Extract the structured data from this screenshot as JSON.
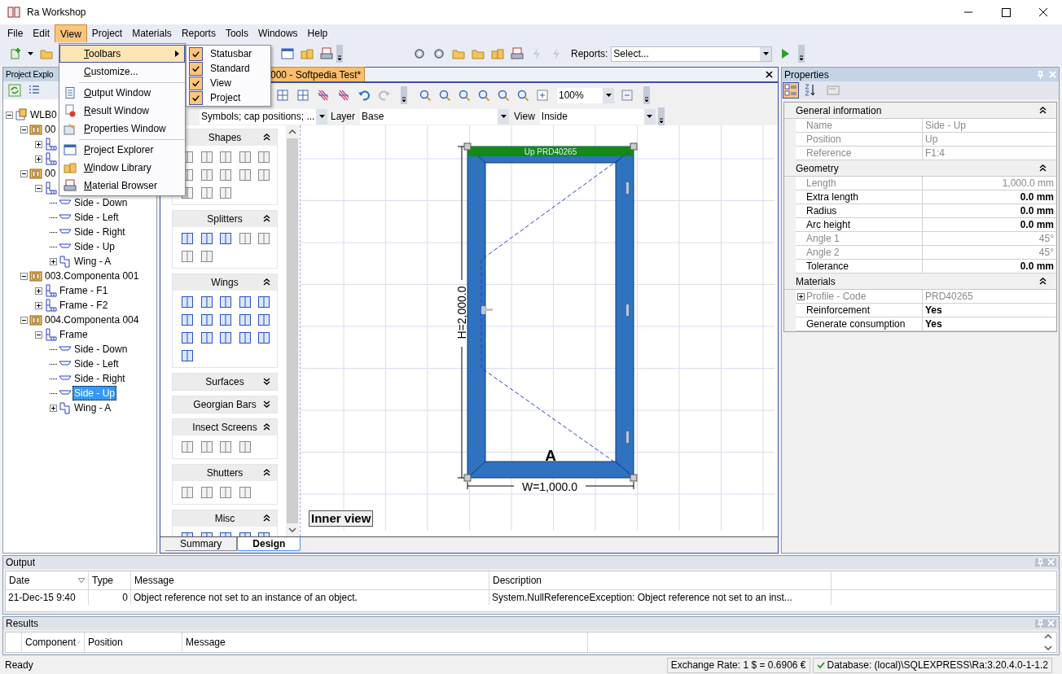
{
  "window": {
    "title": "Ra Workshop"
  },
  "menu": [
    {
      "label": "File",
      "selected": false
    },
    {
      "label": "Edit",
      "selected": false
    },
    {
      "label": "View",
      "selected": true
    },
    {
      "label": "Project",
      "selected": false
    },
    {
      "label": "Materials",
      "selected": false
    },
    {
      "label": "Reports",
      "selected": false
    },
    {
      "label": "Tools",
      "selected": false
    },
    {
      "label": "Windows",
      "selected": false
    },
    {
      "label": "Help",
      "selected": false
    }
  ],
  "view_menu": {
    "groups": [
      [
        {
          "label": "Toolbars",
          "kind": "submenu",
          "selected": true
        },
        {
          "label": "Customize...",
          "kind": "item",
          "selected": false
        }
      ],
      [
        {
          "label": "Output Window",
          "kind": "item",
          "selected": false
        },
        {
          "label": "Result Window",
          "kind": "item",
          "selected": false
        },
        {
          "label": "Properties Window",
          "kind": "item",
          "selected": false
        }
      ],
      [
        {
          "label": "Project Explorer",
          "kind": "item",
          "selected": false
        },
        {
          "label": "Window Library",
          "kind": "item",
          "selected": false
        },
        {
          "label": "Material Browser",
          "kind": "item",
          "selected": false
        }
      ]
    ]
  },
  "toolbars_submenu": [
    {
      "label": "Statusbar",
      "checked": true
    },
    {
      "label": "Standard",
      "checked": true
    },
    {
      "label": "View",
      "checked": true
    },
    {
      "label": "Project",
      "checked": true
    }
  ],
  "toolbar": {
    "reports_label": "Reports:",
    "reports_select": "Select..."
  },
  "project_explorer": {
    "title": "Project Explo",
    "tree": [
      {
        "label": "WLB0",
        "kind": "project",
        "expanded": true,
        "selected": false,
        "children": [
          {
            "label": "00",
            "kind": "component",
            "expanded": true,
            "selected": false,
            "children": [
              {
                "kind": "frame",
                "expanded": false,
                "selected": false
              },
              {
                "kind": "frame",
                "expanded": false,
                "selected": false
              }
            ]
          },
          {
            "label": "00",
            "kind": "component",
            "expanded": true,
            "selected": false,
            "children": [
              {
                "kind": "frame",
                "expanded": true,
                "selected": false,
                "children": [
                  {
                    "label": "Side - Down",
                    "kind": "side",
                    "selected": false
                  },
                  {
                    "label": "Side - Left",
                    "kind": "side",
                    "selected": false
                  },
                  {
                    "label": "Side - Right",
                    "kind": "side",
                    "selected": false
                  },
                  {
                    "label": "Side - Up",
                    "kind": "side",
                    "selected": false
                  },
                  {
                    "label": "Wing - A",
                    "kind": "wing",
                    "expanded": false,
                    "selected": false
                  }
                ]
              }
            ]
          },
          {
            "label": "003.Componenta 001",
            "kind": "component",
            "expanded": true,
            "selected": false,
            "children": [
              {
                "label": "Frame - F1",
                "kind": "frame",
                "expanded": false,
                "selected": false
              },
              {
                "label": "Frame - F2",
                "kind": "frame",
                "expanded": false,
                "selected": false
              }
            ]
          },
          {
            "label": "004.Componenta 004",
            "kind": "component",
            "expanded": true,
            "selected": false,
            "children": [
              {
                "label": "Frame",
                "kind": "frame",
                "expanded": true,
                "selected": false,
                "children": [
                  {
                    "label": "Side - Down",
                    "kind": "side",
                    "selected": false
                  },
                  {
                    "label": "Side - Left",
                    "kind": "side",
                    "selected": false
                  },
                  {
                    "label": "Side - Right",
                    "kind": "side",
                    "selected": false
                  },
                  {
                    "label": "Side - Up",
                    "kind": "side",
                    "selected": true
                  },
                  {
                    "label": "Wing - A",
                    "kind": "wing",
                    "expanded": false,
                    "selected": false
                  }
                ]
              }
            ]
          }
        ]
      }
    ]
  },
  "document": {
    "tab": "000 - Softpedia Test*",
    "zoom": "100%",
    "symbols": "Symbols; cap positions; ...",
    "layer_label": "Layer",
    "layer": "Base",
    "view_label": "View",
    "view": "Inside",
    "palette": [
      {
        "title": "Shapes",
        "expanded": true
      },
      {
        "title": "Splitters",
        "expanded": true
      },
      {
        "title": "Wings",
        "expanded": true
      },
      {
        "title": "Surfaces",
        "expanded": false
      },
      {
        "title": "Georgian Bars",
        "expanded": false
      },
      {
        "title": "Insect Screens",
        "expanded": true
      },
      {
        "title": "Shutters",
        "expanded": true
      },
      {
        "title": "Misc",
        "expanded": true
      }
    ],
    "drawing": {
      "profile_label": "Up PRD40265",
      "wing_label": "A",
      "height_label": "H=2,000.0",
      "width_label": "W=1,000.0",
      "view_label": "Inner view"
    },
    "tabs": [
      {
        "label": "Summary",
        "selected": false
      },
      {
        "label": "Design",
        "selected": true
      }
    ]
  },
  "properties": {
    "title": "Properties",
    "sections": [
      {
        "title": "General information",
        "kind": "text",
        "expanded": true,
        "rows": [
          {
            "label": "Name",
            "value": "Side - Up",
            "readonly": true,
            "modified": false
          },
          {
            "label": "Position",
            "value": "Up",
            "readonly": true,
            "modified": false
          },
          {
            "label": "Reference",
            "value": "F1:4",
            "readonly": true,
            "modified": false
          }
        ]
      },
      {
        "title": "Geometry",
        "kind": "measures",
        "expanded": true,
        "rows": [
          {
            "label": "Length",
            "value": "1,000.0 mm",
            "readonly": true,
            "modified": false
          },
          {
            "label": "Extra length",
            "value": "0.0 mm",
            "readonly": false,
            "modified": true
          },
          {
            "label": "Radius",
            "value": "0.0 mm",
            "readonly": false,
            "modified": true
          },
          {
            "label": "Arc height",
            "value": "0.0 mm",
            "readonly": false,
            "modified": true
          },
          {
            "label": "Angle 1",
            "value": "45°",
            "readonly": true,
            "modified": false
          },
          {
            "label": "Angle 2",
            "value": "45°",
            "readonly": true,
            "modified": false
          },
          {
            "label": "Tolerance",
            "value": "0.0 mm",
            "readonly": false,
            "modified": true
          }
        ]
      },
      {
        "title": "Materials",
        "kind": "text",
        "expanded": true,
        "rows": [
          {
            "label": "Profile - Code",
            "value": "PRD40265",
            "readonly": true,
            "modified": false,
            "expanded": false
          },
          {
            "label": "Reinforcement",
            "value": "Yes",
            "readonly": false,
            "modified": true
          },
          {
            "label": "Generate consumption",
            "value": "Yes",
            "readonly": false,
            "modified": true
          }
        ]
      }
    ]
  },
  "output": {
    "title": "Output",
    "columns": [
      "Date",
      "Type",
      "Message",
      "Description"
    ],
    "rows": [
      [
        "21-Dec-15 9:40",
        "0",
        "Object reference not set to an instance of an object.",
        "System.NullReferenceException: Object reference not set to an inst..."
      ]
    ]
  },
  "results": {
    "title": "Results",
    "columns": [
      "Component",
      "Position",
      "Message"
    ]
  },
  "status_bar": {
    "message": "Ready",
    "exchange_rate": "Exchange Rate: 1 $ = 0.6906 €",
    "database": "Database: (local)\\SQLEXPRESS\\Ra:3.20.4.0-1-1.2"
  }
}
